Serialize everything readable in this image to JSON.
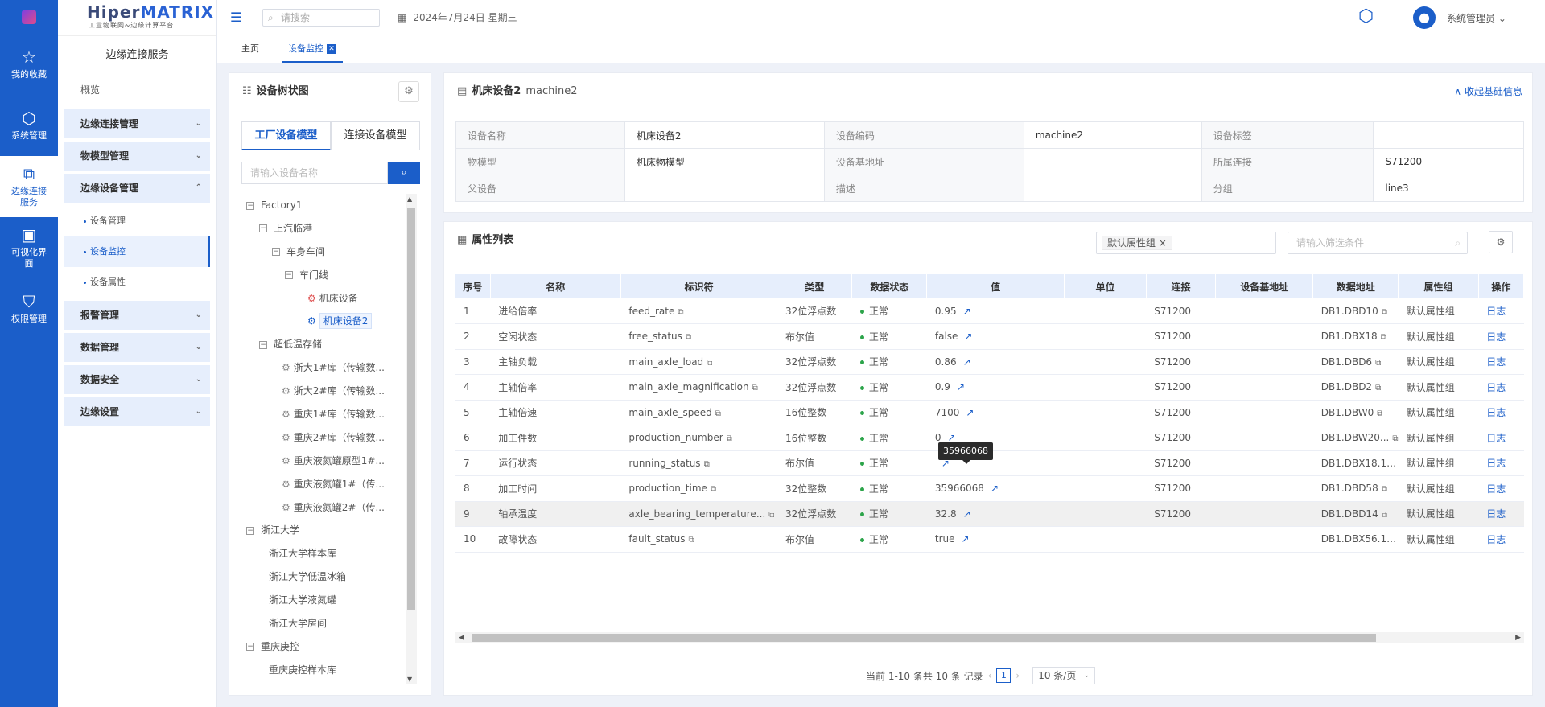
{
  "rail": {
    "items": [
      {
        "label": "我的收藏",
        "icon": "star-icon"
      },
      {
        "label": "系统管理",
        "icon": "cube-icon"
      },
      {
        "label": "边缘连接服务",
        "icon": "copy-icon"
      },
      {
        "label": "可视化界面",
        "icon": "chart-icon"
      },
      {
        "label": "权限管理",
        "icon": "shield-icon"
      }
    ]
  },
  "brand": {
    "name_prefix": "Hiper",
    "name_suffix": "MATRIX",
    "subtitle": "工业物联网&边缘计算平台"
  },
  "sidebar": {
    "title": "边缘连接服务",
    "overview": "概览",
    "groups": [
      {
        "label": "边缘连接管理"
      },
      {
        "label": "物模型管理"
      },
      {
        "label": "边缘设备管理"
      },
      {
        "label": "报警管理"
      },
      {
        "label": "数据管理"
      },
      {
        "label": "数据安全"
      },
      {
        "label": "边缘设置"
      }
    ],
    "sub_items": [
      {
        "label": "设备管理"
      },
      {
        "label": "设备监控"
      },
      {
        "label": "设备属性"
      }
    ]
  },
  "header": {
    "search_placeholder": "请搜索",
    "date": "2024年7月24日 星期三",
    "user": "系统管理员"
  },
  "tabs": [
    {
      "label": "主页"
    },
    {
      "label": "设备监控"
    }
  ],
  "tree": {
    "title": "设备树状图",
    "tab_factory": "工厂设备模型",
    "tab_connection": "连接设备模型",
    "search_placeholder": "请输入设备名称",
    "nodes": [
      {
        "label": "Factory1",
        "level": 0,
        "toggle": "−"
      },
      {
        "label": "上汽临港",
        "level": 1,
        "toggle": "−"
      },
      {
        "label": "车身车间",
        "level": 2,
        "toggle": "−"
      },
      {
        "label": "车门线",
        "level": 3,
        "toggle": "−"
      },
      {
        "label": "机床设备",
        "level": 4,
        "icon": "red"
      },
      {
        "label": "机床设备2",
        "level": 4,
        "icon": "blue",
        "selected": true
      },
      {
        "label": "超低温存储",
        "level": 1,
        "toggle": "−"
      },
      {
        "label": "浙大1#库（传输数...",
        "level": 2,
        "icon": "grey"
      },
      {
        "label": "浙大2#库（传输数...",
        "level": 2,
        "icon": "grey"
      },
      {
        "label": "重庆1#库（传输数...",
        "level": 2,
        "icon": "grey"
      },
      {
        "label": "重庆2#库（传输数...",
        "level": 2,
        "icon": "grey"
      },
      {
        "label": "重庆液氮罐原型1#...",
        "level": 2,
        "icon": "grey"
      },
      {
        "label": "重庆液氮罐1#（传...",
        "level": 2,
        "icon": "grey"
      },
      {
        "label": "重庆液氮罐2#（传...",
        "level": 2,
        "icon": "grey"
      },
      {
        "label": "浙江大学",
        "level": 0,
        "toggle": "−"
      },
      {
        "label": "浙江大学样本库",
        "level": 1
      },
      {
        "label": "浙江大学低温冰箱",
        "level": 1
      },
      {
        "label": "浙江大学液氮罐",
        "level": 1
      },
      {
        "label": "浙江大学房间",
        "level": 1
      },
      {
        "label": "重庆庚控",
        "level": 0,
        "toggle": "−"
      },
      {
        "label": "重庆庚控样本库",
        "level": 1
      }
    ]
  },
  "device": {
    "title": "机床设备2",
    "code": "machine2",
    "collapse_label": "收起基础信息",
    "fields": [
      [
        "设备名称",
        "机床设备2",
        "设备编码",
        "machine2",
        "设备标签",
        ""
      ],
      [
        "物模型",
        "机床物模型",
        "设备基地址",
        "",
        "所属连接",
        "S71200"
      ],
      [
        "父设备",
        "",
        "描述",
        "",
        "分组",
        "line3"
      ]
    ]
  },
  "attributes": {
    "title": "属性列表",
    "filter_chip": "默认属性组",
    "search_placeholder": "请输入筛选条件",
    "columns": [
      "序号",
      "名称",
      "标识符",
      "类型",
      "数据状态",
      "值",
      "单位",
      "连接",
      "设备基地址",
      "数据地址",
      "属性组",
      "操作"
    ],
    "rows": [
      {
        "no": "1",
        "name": "进给倍率",
        "id": "feed_rate",
        "type": "32位浮点数",
        "status": "正常",
        "value": "0.95",
        "unit": "",
        "conn": "S71200",
        "base": "",
        "addr": "DB1.DBD10",
        "group": "默认属性组",
        "op": "日志"
      },
      {
        "no": "2",
        "name": "空闲状态",
        "id": "free_status",
        "type": "布尔值",
        "status": "正常",
        "value": "false",
        "unit": "",
        "conn": "S71200",
        "base": "",
        "addr": "DB1.DBX18",
        "group": "默认属性组",
        "op": "日志"
      },
      {
        "no": "3",
        "name": "主轴负载",
        "id": "main_axle_load",
        "type": "32位浮点数",
        "status": "正常",
        "value": "0.86",
        "unit": "",
        "conn": "S71200",
        "base": "",
        "addr": "DB1.DBD6",
        "group": "默认属性组",
        "op": "日志"
      },
      {
        "no": "4",
        "name": "主轴倍率",
        "id": "main_axle_magnification",
        "type": "32位浮点数",
        "status": "正常",
        "value": "0.9",
        "unit": "",
        "conn": "S71200",
        "base": "",
        "addr": "DB1.DBD2",
        "group": "默认属性组",
        "op": "日志"
      },
      {
        "no": "5",
        "name": "主轴倍速",
        "id": "main_axle_speed",
        "type": "16位整数",
        "status": "正常",
        "value": "7100",
        "unit": "",
        "conn": "S71200",
        "base": "",
        "addr": "DB1.DBW0",
        "group": "默认属性组",
        "op": "日志"
      },
      {
        "no": "6",
        "name": "加工件数",
        "id": "production_number",
        "type": "16位整数",
        "status": "正常",
        "value": "0",
        "unit": "",
        "conn": "S71200",
        "base": "",
        "addr": "DB1.DBW20...",
        "group": "默认属性组",
        "op": "日志"
      },
      {
        "no": "7",
        "name": "运行状态",
        "id": "running_status",
        "type": "布尔值",
        "status": "正常",
        "value": "",
        "unit": "",
        "conn": "S71200",
        "base": "",
        "addr": "DB1.DBX18.1...",
        "group": "默认属性组",
        "op": "日志"
      },
      {
        "no": "8",
        "name": "加工时间",
        "id": "production_time",
        "type": "32位整数",
        "status": "正常",
        "value": "35966068",
        "unit": "",
        "conn": "S71200",
        "base": "",
        "addr": "DB1.DBD58",
        "group": "默认属性组",
        "op": "日志"
      },
      {
        "no": "9",
        "name": "轴承温度",
        "id": "axle_bearing_temperature...",
        "type": "32位浮点数",
        "status": "正常",
        "value": "32.8",
        "unit": "",
        "conn": "S71200",
        "base": "",
        "addr": "DB1.DBD14",
        "group": "默认属性组",
        "op": "日志"
      },
      {
        "no": "10",
        "name": "故障状态",
        "id": "fault_status",
        "type": "布尔值",
        "status": "正常",
        "value": "true",
        "unit": "",
        "conn": "",
        "base": "",
        "addr": "DB1.DBX56.1...",
        "group": "默认属性组",
        "op": "日志"
      }
    ],
    "tooltip": "35966068",
    "pagination": {
      "summary": "当前 1-10 条共 10 条 记录",
      "current": "1",
      "page_size": "10 条/页"
    }
  }
}
